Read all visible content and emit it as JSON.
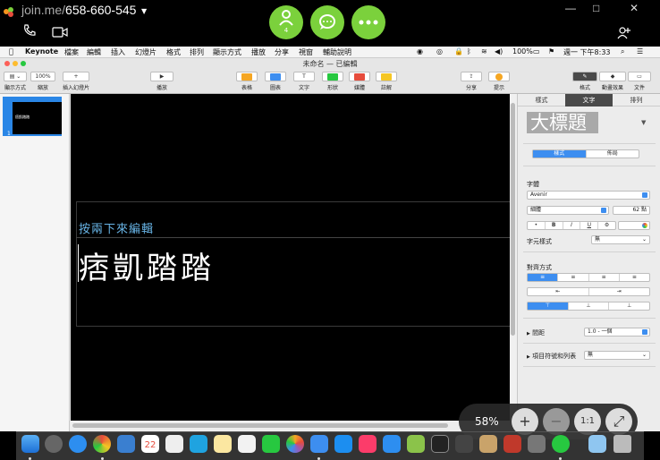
{
  "joinme": {
    "logo_text": "join.me/",
    "meeting_code": "658-660-545",
    "participants_count": "4",
    "window_controls": [
      "—",
      "□",
      "✕"
    ]
  },
  "mac_menu": {
    "app": "Keynote",
    "items": [
      "檔案",
      "編輯",
      "插入",
      "幻燈片",
      "格式",
      "排列",
      "顯示方式",
      "播放",
      "分享",
      "視窗",
      "輔助說明"
    ],
    "battery": "100%",
    "clock": "週一 下午8:33"
  },
  "window": {
    "title": "未命名 — 已編輯"
  },
  "toolbar": {
    "view_label": "顯示方式",
    "zoom_value": "100%",
    "zoom_label": "縮放",
    "add_slide_label": "插入幻燈片",
    "play_label": "播放",
    "table_label": "表格",
    "chart_label": "圖表",
    "text_label": "文字",
    "shape_label": "形狀",
    "media_label": "媒體",
    "comment_label": "註解",
    "share_label": "分享",
    "tips_label": "提示",
    "format_label": "格式",
    "animate_label": "動畫效果",
    "document_label": "文件"
  },
  "slides_panel": {
    "thumb_title": "痞凱踏踏",
    "slide_number": "1"
  },
  "slide": {
    "hint_text": "按兩下來編輯",
    "title_text": "痞凱踏踏"
  },
  "inspector": {
    "tabs": [
      "樣式",
      "文字",
      "排列"
    ],
    "active_tab": "文字",
    "paragraph_style": "大標題",
    "sub_tabs": [
      "樣式",
      "佈局"
    ],
    "font_section": "字體",
    "font_name": "Avenir",
    "font_weight": "細體",
    "font_size": "62 點",
    "style_buttons": [
      "•",
      "B",
      "I",
      "U",
      "⚙"
    ],
    "char_style_label": "字元樣式",
    "char_style_value": "無",
    "alignment_label": "對齊方式",
    "align_buttons": [
      "≡",
      "≡",
      "≡",
      "≡"
    ],
    "indent_buttons": [
      "⇤",
      "⇥"
    ],
    "valign_buttons": [
      "⊤",
      "⊥",
      "⊥"
    ],
    "spacing_label": "間距",
    "spacing_value": "1.0 - 一個",
    "bullets_label": "項目符號和列表",
    "bullets_value": "無"
  },
  "zoom_overlay": {
    "percent": "58%",
    "plus": "+",
    "minus": "−",
    "one_to_one": "1:1",
    "fit": "⤢"
  },
  "dock": {
    "calendar_day": "22"
  }
}
